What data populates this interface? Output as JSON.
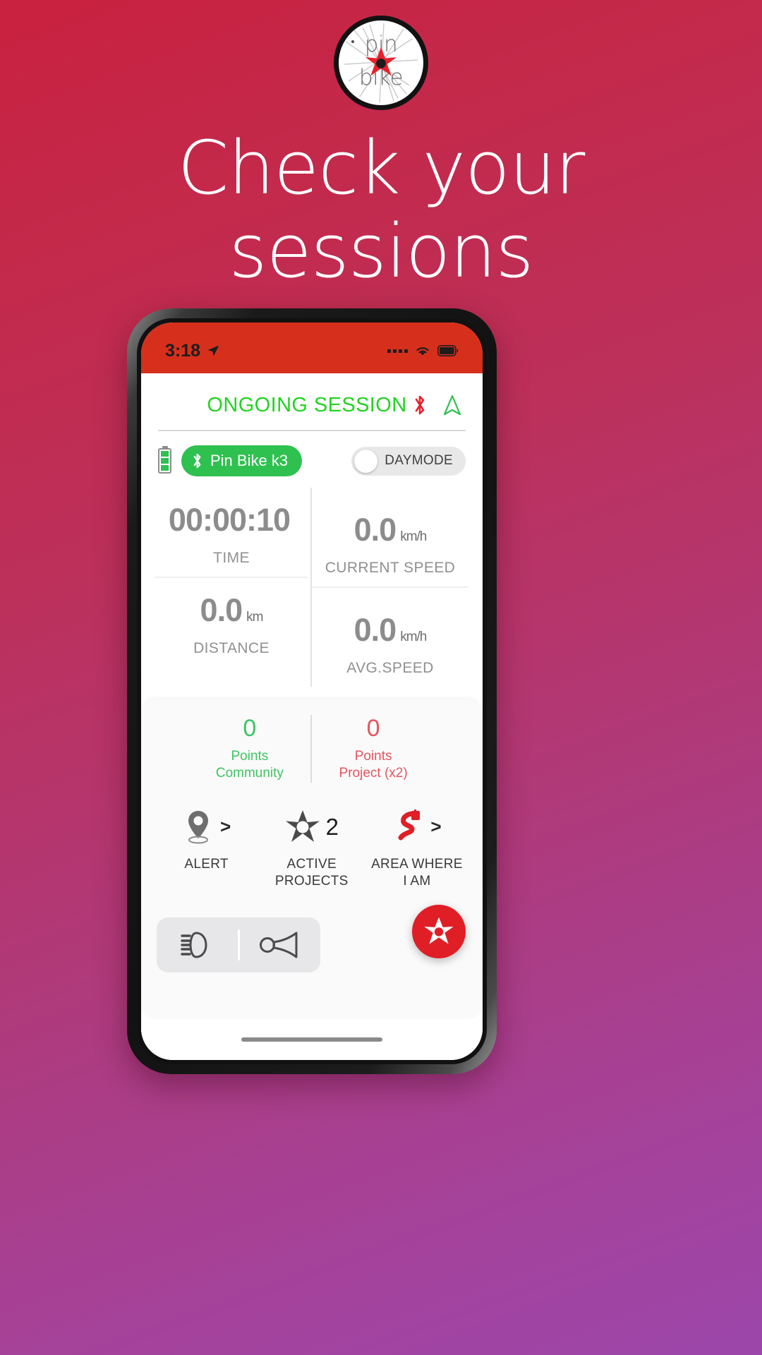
{
  "promo": {
    "headline_line1": "Check your",
    "headline_line2": "sessions",
    "logo": {
      "top_text": "pin",
      "bottom_text": "bike",
      "alt": "pin-bike-logo"
    },
    "background_gradient_from": "#c9213f",
    "background_gradient_to": "#9c46ab"
  },
  "phone": {
    "statusbar": {
      "time": "3:18",
      "location_icon": "location-arrow-icon",
      "signal_icon": "signal-dots-icon",
      "wifi_icon": "wifi-icon",
      "battery_icon": "battery-full-icon",
      "background": "#d6301d"
    },
    "header": {
      "title": "ONGOING SESSION",
      "title_color": "#22d422",
      "bluetooth_icon": "bluetooth-icon",
      "bluetooth_color": "#e8212d",
      "navigation_icon": "navigation-triangle-icon",
      "navigation_color": "#2ec14f"
    },
    "device": {
      "battery_level_icon": "battery-vertical-icon",
      "bluetooth_icon": "bluetooth-icon",
      "name": "Pin Bike k3",
      "pill_color": "#2ec14f",
      "daymode_label": "DAYMODE",
      "daymode_on": false
    },
    "metrics": [
      {
        "value": "00:00:10",
        "unit": "",
        "label": "TIME"
      },
      {
        "value": "0.0",
        "unit": "km/h",
        "label": "CURRENT SPEED"
      },
      {
        "value": "0.0",
        "unit": "km",
        "label": "DISTANCE"
      },
      {
        "value": "0.0",
        "unit": "km/h",
        "label": "AVG.SPEED"
      }
    ],
    "points": [
      {
        "value": "0",
        "label_line1": "Points",
        "label_line2": "Community",
        "color": "#3fc462"
      },
      {
        "value": "0",
        "label_line1": "Points",
        "label_line2": "Project (x2)",
        "color": "#e4555f"
      }
    ],
    "actions": [
      {
        "icon": "map-pin-icon",
        "label_line1": "ALERT",
        "label_line2": "",
        "chevron": ">",
        "count": ""
      },
      {
        "icon": "star-project-icon",
        "label_line1": "ACTIVE",
        "label_line2": "PROJECTS",
        "chevron": "",
        "count": "2"
      },
      {
        "icon": "road-area-icon",
        "label_line1": "AREA WHERE",
        "label_line2": "I AM",
        "chevron": ">",
        "count": ""
      }
    ],
    "controls": [
      {
        "icon": "headlight-icon"
      },
      {
        "icon": "horn-icon"
      }
    ],
    "fab": {
      "icon": "star-fab-icon",
      "color": "#e01e26"
    }
  }
}
